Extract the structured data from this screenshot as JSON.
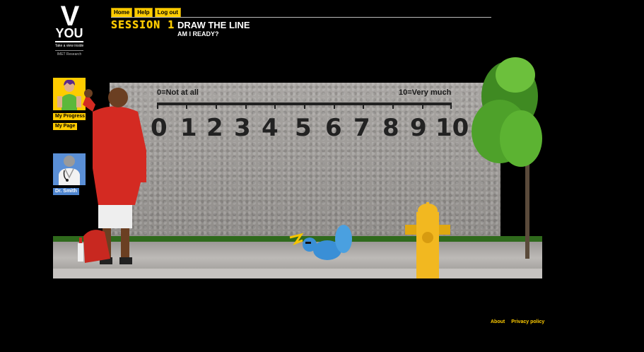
{
  "logo": {
    "letter": "V",
    "word": "YOU",
    "tagline": "Take a view inside",
    "org": "IMET Research"
  },
  "nav": [
    {
      "id": "home",
      "label": "Home"
    },
    {
      "id": "help",
      "label": "Help"
    },
    {
      "id": "logout",
      "label": "Log out"
    }
  ],
  "session": {
    "label": "SESSION 1",
    "title": "DRAW THE LINE",
    "subtitle": "AM I READY?"
  },
  "sidebar": {
    "my_progress": "My Progress",
    "my_page": "My Page",
    "doctor": "Dr. Smith"
  },
  "scale": {
    "low_label": "0=Not at all",
    "high_label": "10=Very much",
    "numbers": [
      "0",
      "1",
      "2",
      "3",
      "4",
      "5",
      "6",
      "7",
      "8",
      "9",
      "10"
    ]
  },
  "footer": {
    "about": "About",
    "privacy": "Privacy policy"
  },
  "colors": {
    "accent": "#ffcc00",
    "doctor": "#4f86d0",
    "background": "#000000"
  }
}
